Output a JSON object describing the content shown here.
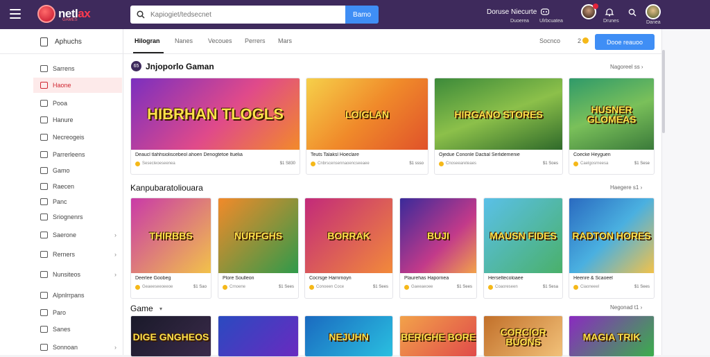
{
  "header": {
    "logo_text_1": "netl",
    "logo_text_2": "ax",
    "logo_sub": "GAMES",
    "search_placeholder": "Kapiogiet/tedsecnet",
    "search_button": "Bamo",
    "right_title": "Doruse Niecurte",
    "right_sub": "Duoerea",
    "right_sub2": "Ulrbcuatea",
    "right_sub3": "Drunes",
    "right_sub4": "Danea"
  },
  "sidebar": {
    "head": "Aphuchs",
    "items": [
      {
        "label": "Sarrens",
        "icon": "home-icon",
        "chev": ""
      },
      {
        "label": "Haone",
        "icon": "fire-icon",
        "chev": ""
      },
      {
        "label": "Pooa",
        "icon": "star-icon",
        "chev": ""
      },
      {
        "label": "Hanure",
        "icon": "clock-icon",
        "chev": ""
      },
      {
        "label": "Necreogeis",
        "icon": "list-icon",
        "chev": ""
      },
      {
        "label": "Parrerleens",
        "icon": "puzzle-icon",
        "chev": ""
      },
      {
        "label": "Gamo",
        "icon": "gamepad-icon",
        "chev": ""
      },
      {
        "label": "Raecen",
        "icon": "trophy-icon",
        "chev": ""
      },
      {
        "label": "Panc",
        "icon": "card-icon",
        "chev": ""
      },
      {
        "label": "Sriognenrs",
        "icon": "grid-icon",
        "chev": ""
      },
      {
        "label": "Saerone",
        "icon": "tag-icon",
        "chev": "›"
      },
      {
        "label": "Rerners",
        "icon": "users-icon",
        "chev": "›"
      },
      {
        "label": "Nunsiteos",
        "icon": "chat-icon",
        "chev": "›"
      },
      {
        "label": "Alpnlrrpans",
        "icon": "map-icon",
        "chev": ""
      },
      {
        "label": "Paro",
        "icon": "box-icon",
        "chev": ""
      },
      {
        "label": "Sanes",
        "icon": "folder-icon",
        "chev": ""
      },
      {
        "label": "Sonnoan",
        "icon": "globe-icon",
        "chev": "›"
      }
    ]
  },
  "tabs": [
    "Hilogran",
    "Nanes",
    "Vecoues",
    "Perrers",
    "Mars"
  ],
  "tabs_right": {
    "label": "Socnco",
    "count": "2"
  },
  "blue_button": "Dooe reauoo",
  "section1": {
    "title": "Jnjoporlo Gaman",
    "more": "Nagoreel ss ›"
  },
  "section2": {
    "title": "Kanpubaratoliouara",
    "more": "Haegere s1 ›"
  },
  "section3": {
    "title": "Game",
    "more": "Negonad t1 ›"
  },
  "row1": [
    {
      "art": "HIBRHAN TLOGLS",
      "t1": "Deaucl tlahhsioliscebeol ahoen Denogtetoe ltuelia",
      "t2": "Sesecleoeseenea",
      "t3": "$1 S830"
    },
    {
      "art": "LOIGLAN",
      "t1": "Teuts Talaksl Hoeclare",
      "t2": "Cnbrscensennaoencseeaee",
      "t3": "$1 ssso"
    },
    {
      "art": "HIRGANO STORES",
      "t1": "Ojedue Cononle Dactial Serlidemenie",
      "t2": "Cnoseeareteaes",
      "t3": "$1 Soes"
    },
    {
      "art": "HUSNER GLOMEAS",
      "t1": "Coecke Heyguen",
      "t2": "Caelgosrneesa",
      "t3": "$1 Sese"
    }
  ],
  "row2": [
    {
      "art": "THIRBBS",
      "t1": "Deerlee Goobeg",
      "t2": "Geaeeseeoeeoe",
      "t3": "$1 Sao"
    },
    {
      "art": "NURFGHS",
      "t1": "Plore Soulleon",
      "t2": "Crnoene",
      "t3": "$1 Sees"
    },
    {
      "art": "BORRAK",
      "t1": "Cocrsge Harnrnoyn",
      "t2": "Conoeen Coce",
      "t3": "$1 Sees"
    },
    {
      "art": "BUJI",
      "t1": "Plaurehas Hapornea",
      "t2": "Gaeeaeoee",
      "t3": "$1 Sees"
    },
    {
      "art": "MAUSN FIDES",
      "t1": "Herseltecoloaee",
      "t2": "Coaoreseen",
      "t3": "$1 Sesa"
    },
    {
      "art": "RADTON HORES",
      "t1": "Heenre & Scaoeel",
      "t2": "Ciaoneeel",
      "t3": "$1 Sees"
    }
  ],
  "row3": [
    {
      "art": "DIGE GNGHEOS"
    },
    {
      "art": ""
    },
    {
      "art": "NEJUHN"
    },
    {
      "art": "BERIGHE BORE"
    },
    {
      "art": "CORCIOR BUONS"
    },
    {
      "art": "MAGIA TRIK"
    }
  ],
  "colors": {
    "header": "#3e2a5c",
    "accent": "#3f8ef5",
    "active": "#d0242f"
  }
}
